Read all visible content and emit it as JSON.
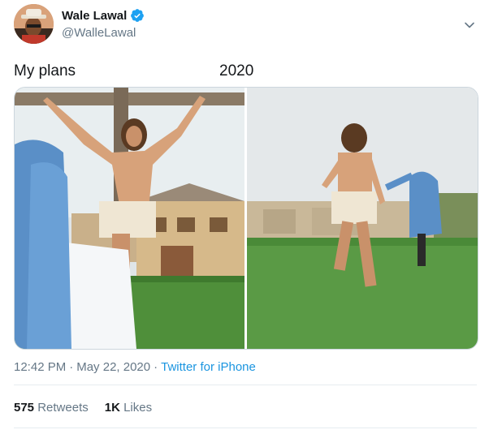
{
  "author": {
    "display_name": "Wale Lawal",
    "handle": "@WalleLawal",
    "verified_icon": "verified-badge-icon",
    "avatar_icon": "avatar"
  },
  "tweet": {
    "text_left": "My plans",
    "text_right": "2020",
    "time": "12:42 PM",
    "separator": "·",
    "date": "May 22, 2020",
    "source": "Twitter for iPhone"
  },
  "stats": {
    "retweets_count": "575",
    "retweets_label": "Retweets",
    "likes_count": "1K",
    "likes_label": "Likes"
  },
  "colors": {
    "link": "#1b95e0",
    "muted": "#657786",
    "text": "#14171a",
    "verified": "#1da1f2"
  }
}
